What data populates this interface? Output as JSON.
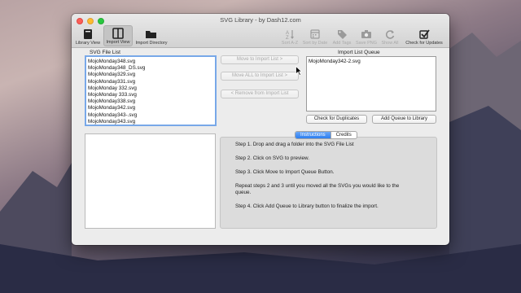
{
  "window": {
    "title": "SVG Library - by Dash12.com"
  },
  "toolbar": {
    "library_view": "Library View",
    "import_view": "Import View",
    "import_directory": "Import Directory",
    "sort_az": "Sort A-Z",
    "sort_by_date": "Sort by Date",
    "add_tags": "Add Tags",
    "save_png": "Save PNG",
    "show_all": "Show All",
    "check_for_updates": "Check for Updates"
  },
  "file_list": {
    "label": "SVG File List",
    "items": [
      "MojoMonday348.svg",
      "MojoMonday348_DS.svg",
      "MojoMonday329.svg",
      "MojoMonday331.svg",
      "MojoMonday 332.svg",
      "MojoMonday 333.svg",
      "MojoMonday338.svg",
      "MojoMonday342.svg",
      "MojoMonday343-.svg",
      "MojoMonday343.svg"
    ]
  },
  "actions": {
    "move": "Move to Import List >",
    "move_all": "Move ALL to Import List >",
    "remove": "< Remove from Import List"
  },
  "queue": {
    "label": "Import List Queue",
    "items": [
      "MojoMonday342-2.svg"
    ],
    "check_duplicates": "Check for Duplicates",
    "add_to_library": "Add Queue to Library"
  },
  "tabs": {
    "instructions": "Instructions",
    "credits": "Credits"
  },
  "instructions": {
    "step1": "Step 1.  Drop and drag a folder into the SVG File List",
    "step2": "Step 2.  Click on SVG to preview.",
    "step3": "Step 3.  Click Move to Import Queue Button.",
    "step4a": "Repeat steps 2 and 3 until you moved all the SVGs you would like to the",
    "step4b": "queue.",
    "step5": "Step 4.  Click Add Queue to Library button to finalize the import."
  },
  "colors": {
    "accent": "#2c7ef0",
    "focus_ring": "#78a8e8"
  }
}
